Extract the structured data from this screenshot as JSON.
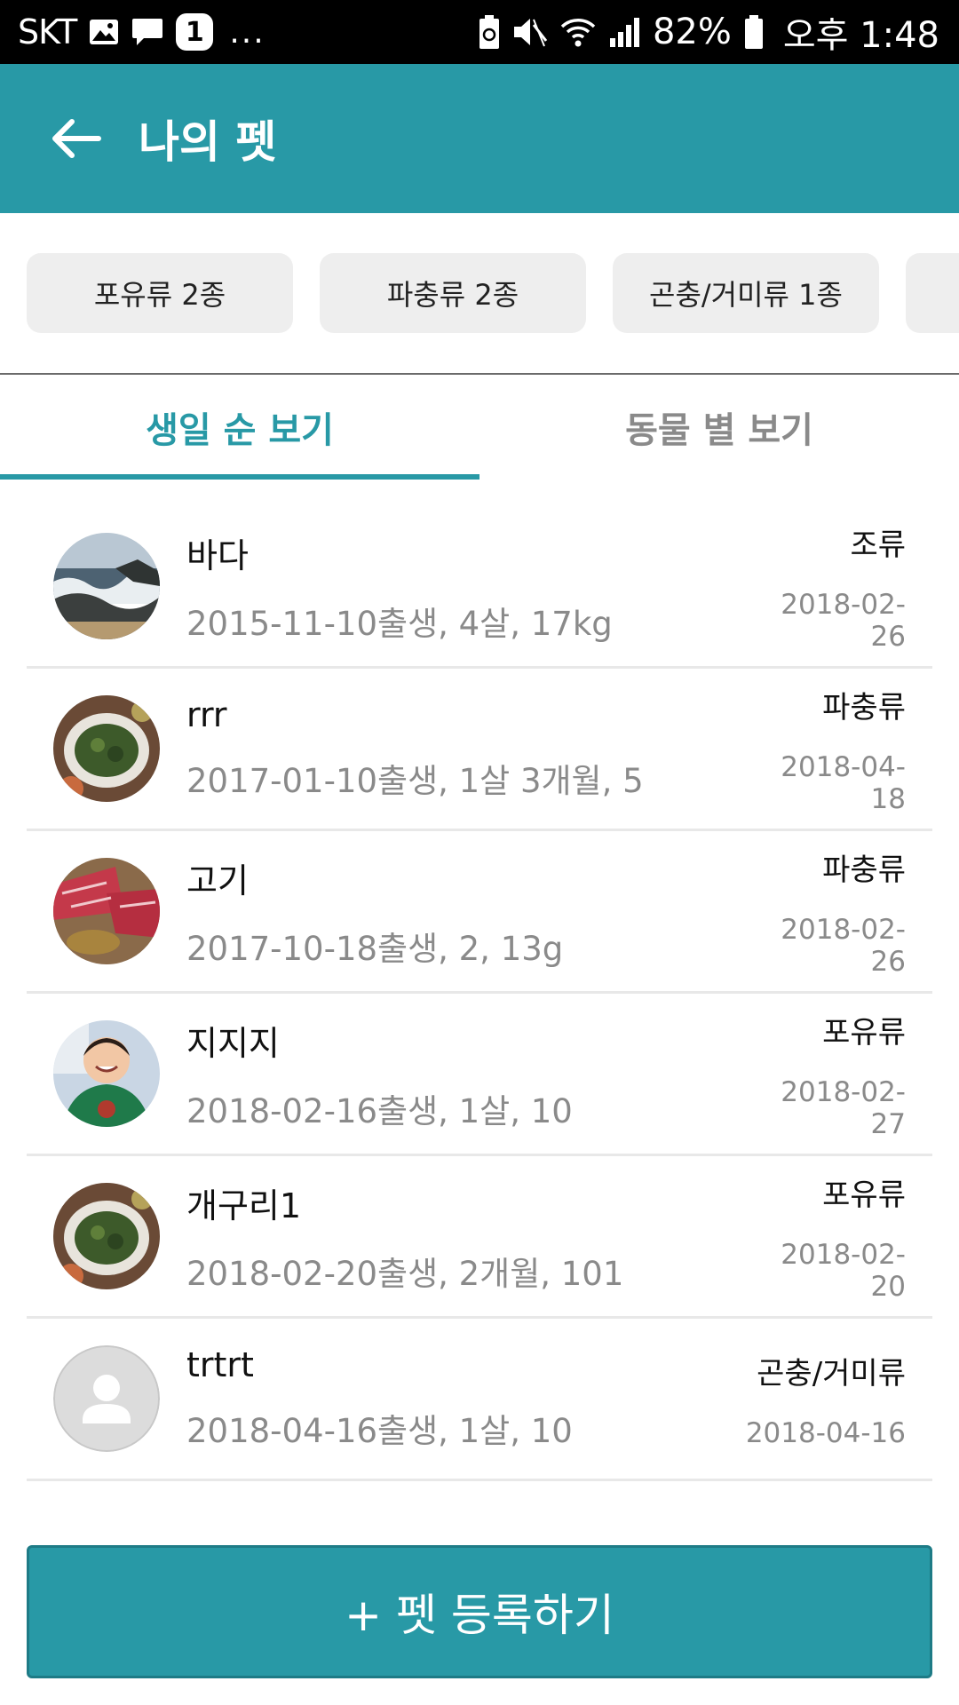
{
  "status_bar": {
    "carrier": "SKT",
    "badge_count": "1",
    "more": "...",
    "battery_percent": "82%",
    "time": "오후 1:48"
  },
  "app_bar": {
    "title": "나의 펫",
    "back_icon": "arrow-left-icon"
  },
  "categories": [
    {
      "label": "포유류 2종"
    },
    {
      "label": "파충류 2종"
    },
    {
      "label": "곤충/거미류 1종"
    },
    {
      "label": ""
    }
  ],
  "tabs": [
    {
      "label": "생일 순 보기",
      "active": true
    },
    {
      "label": "동물 별 보기",
      "active": false
    }
  ],
  "pets": [
    {
      "name": "바다",
      "info": "2015-11-10출생, 4살, 17kg",
      "type": "조류",
      "date": "2018-02-26",
      "photo": "sea-photo"
    },
    {
      "name": "rrr",
      "info": "2017-01-10출생, 1살 3개월, 5",
      "type": "파충류",
      "date": "2018-04-18",
      "photo": "food-plate-photo"
    },
    {
      "name": "고기",
      "info": "2017-10-18출생, 2, 13g",
      "type": "파충류",
      "date": "2018-02-26",
      "photo": "meat-photo"
    },
    {
      "name": "지지지",
      "info": "2018-02-16출생, 1살, 10",
      "type": "포유류",
      "date": "2018-02-27",
      "photo": "child-photo"
    },
    {
      "name": "개구리1",
      "info": "2018-02-20출생, 2개월, 101",
      "type": "포유류",
      "date": "2018-02-20",
      "photo": "food-plate-photo"
    },
    {
      "name": "trtrt",
      "info": "2018-04-16출생, 1살, 10",
      "type": "곤충/거미류",
      "date": "2018-04-16",
      "photo": "default-avatar"
    }
  ],
  "register_button": {
    "label": "+ 펫 등록하기"
  },
  "colors": {
    "primary": "#2899a6",
    "chip_bg": "#eeeeee",
    "secondary_text": "#8a8a8a"
  }
}
